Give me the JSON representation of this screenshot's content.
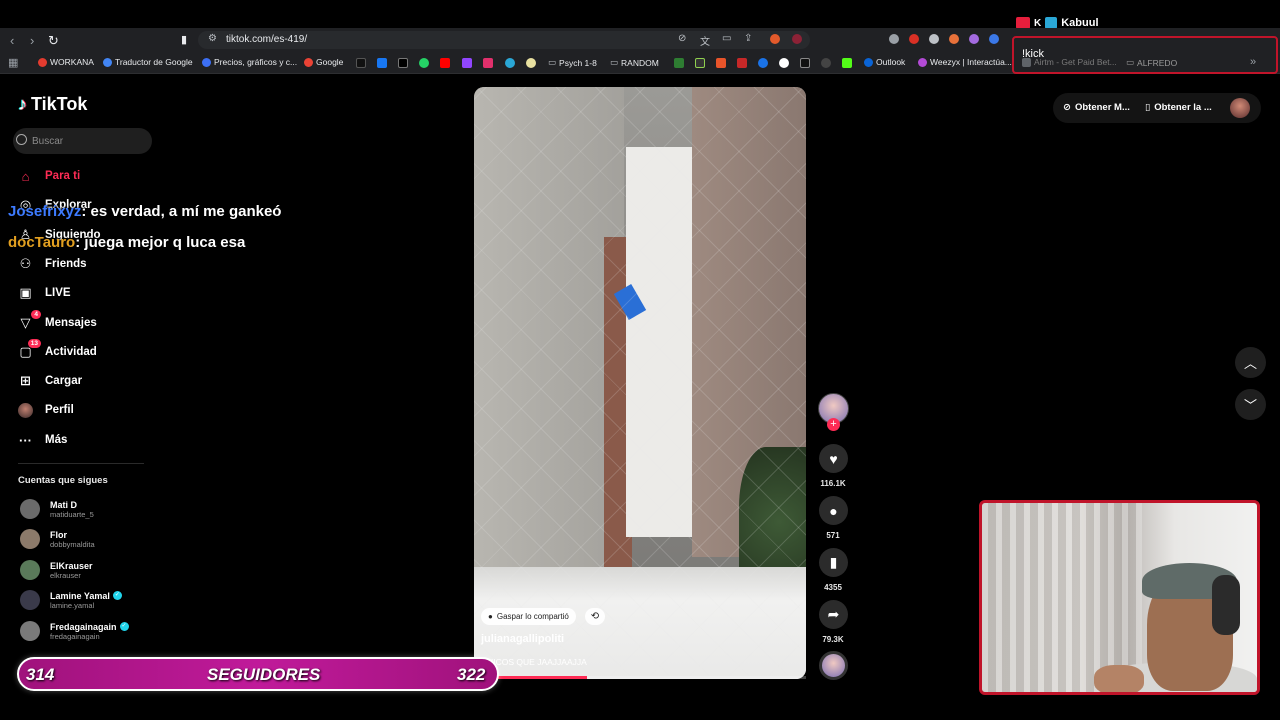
{
  "stream_overlay": {
    "kabuul_label": "Kabuul",
    "kick_label": "!kick",
    "chat": [
      {
        "user": "Josefrixyz",
        "message": ": es verdad, a mí me gankeó"
      },
      {
        "user": "docTauro",
        "message": ": juega mejor q luca esa"
      }
    ],
    "followers": {
      "current": "314",
      "label": "SEGUIDORES",
      "goal": "322"
    }
  },
  "browser": {
    "url": "tiktok.com/es-419/",
    "bookmarks": [
      {
        "label": "WORKANA",
        "color": "#e33b2f"
      },
      {
        "label": "Traductor de Google",
        "color": "#4285f4"
      },
      {
        "label": "Precios, gráficos y c...",
        "color": "#3c6ff4"
      },
      {
        "label": "Google",
        "color": "#ea4335"
      },
      {
        "label": "Psych 1-8",
        "color": "#9aa0a6"
      },
      {
        "label": "RANDOM",
        "color": "#9aa0a6"
      },
      {
        "label": "Outlook",
        "color": "#0a64d6"
      },
      {
        "label": "Weezyx | Interactúa...",
        "color": "#b34ad6"
      },
      {
        "label": "Airtm - Get Paid Bet...",
        "color": "#5f6368"
      },
      {
        "label": "ALFREDO",
        "color": "#9aa0a6"
      }
    ]
  },
  "tiktok": {
    "logo": "TikTok",
    "search_placeholder": "Buscar",
    "nav": [
      {
        "label": "Para ti",
        "icon": "home-icon"
      },
      {
        "label": "Explorar",
        "icon": "compass-icon"
      },
      {
        "label": "Siguiendo",
        "icon": "following-icon"
      },
      {
        "label": "Friends",
        "icon": "friends-icon"
      },
      {
        "label": "LIVE",
        "icon": "live-icon"
      },
      {
        "label": "Mensajes",
        "icon": "messages-icon",
        "badge": "4"
      },
      {
        "label": "Actividad",
        "icon": "activity-icon",
        "badge": "13"
      },
      {
        "label": "Cargar",
        "icon": "upload-icon"
      },
      {
        "label": "Perfil",
        "icon": "profile-icon"
      },
      {
        "label": "Más",
        "icon": "more-icon"
      }
    ],
    "following_title": "Cuentas que sigues",
    "following": [
      {
        "name": "Mati D",
        "user": "matiduarte_5",
        "verified": false,
        "color": "#6b6b6b"
      },
      {
        "name": "Flor",
        "user": "dobbymaldita",
        "verified": false,
        "color": "#8c7a6a"
      },
      {
        "name": "ElKrauser",
        "user": "elkrauser",
        "verified": false,
        "color": "#5a7a5a"
      },
      {
        "name": "Lamine Yamal",
        "user": "lamine.yamal",
        "verified": true,
        "color": "#3a3a4a"
      },
      {
        "name": "Fredagainagain",
        "user": "fredagainagain",
        "verified": true,
        "color": "#7a7a7a"
      }
    ],
    "top_right": {
      "get_app_1": "Obtener M...",
      "get_app_2": "Obtener la ..."
    },
    "video": {
      "shared_by": "Gaspar lo compartió",
      "username": "julianagallipoliti",
      "caption": "CHICOS QUE JAAJJAAJJA",
      "progress": 0.34,
      "likes": "116.1K",
      "comments": "571",
      "saves": "4355",
      "shares": "79.3K"
    }
  },
  "colors": {
    "accent": "#fe2c55",
    "kick_red": "#c0142a",
    "follower_bar": "#b01690"
  }
}
